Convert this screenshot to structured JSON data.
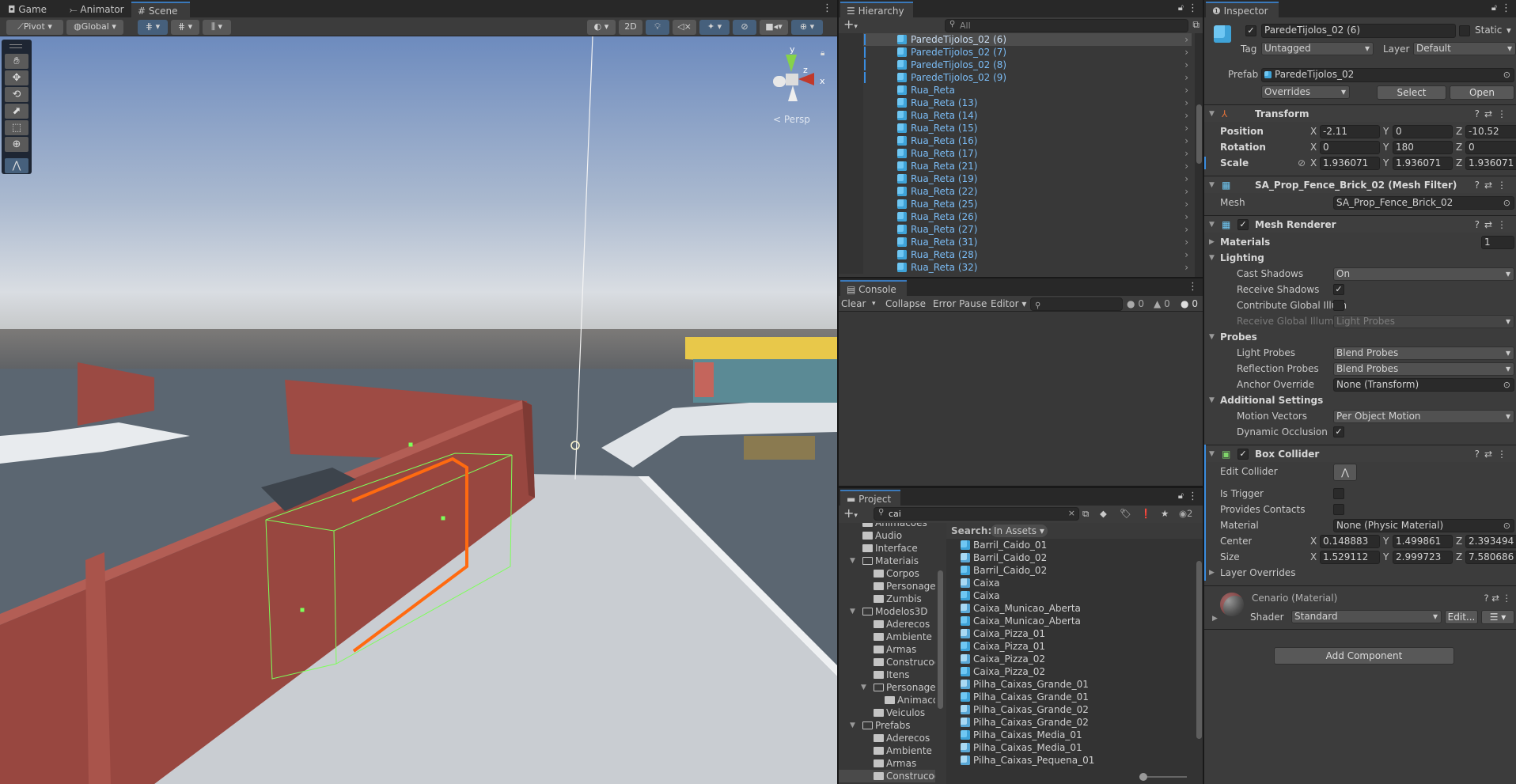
{
  "scene_panel": {
    "tabs": [
      {
        "label": "Game",
        "icon": "gamepad-icon"
      },
      {
        "label": "Animator",
        "icon": "animator-icon"
      },
      {
        "label": "Scene",
        "icon": "grid-hash-icon",
        "active": true
      }
    ],
    "toolbar": {
      "pivot": "Pivot",
      "global": "Global",
      "mode_2d": "2D"
    },
    "tools": [
      "hand-tool",
      "move-tool",
      "rotate-tool",
      "scale-tool",
      "rect-tool",
      "transform-tool",
      "edit-collider-tool"
    ],
    "gizmo": {
      "y": "y",
      "x": "x",
      "z": "z",
      "projection": "Persp"
    },
    "colors": {
      "sky_top": "#6f8cbf",
      "horizon": "#dfe2e4",
      "ground": "#5d6670",
      "brick": "#9b4a43",
      "collider": "#7dff5a",
      "selection": "#ff6a10"
    }
  },
  "hierarchy": {
    "title": "Hierarchy",
    "search_placeholder": "All",
    "items": [
      {
        "label": "ParedeTijolos_02 (6)",
        "selected": true
      },
      {
        "label": "ParedeTijolos_02 (7)"
      },
      {
        "label": "ParedeTijolos_02 (8)"
      },
      {
        "label": "ParedeTijolos_02 (9)"
      },
      {
        "label": "Rua_Reta"
      },
      {
        "label": "Rua_Reta (13)"
      },
      {
        "label": "Rua_Reta (14)"
      },
      {
        "label": "Rua_Reta (15)"
      },
      {
        "label": "Rua_Reta (16)"
      },
      {
        "label": "Rua_Reta (17)"
      },
      {
        "label": "Rua_Reta (21)"
      },
      {
        "label": "Rua_Reta (19)"
      },
      {
        "label": "Rua_Reta (22)"
      },
      {
        "label": "Rua_Reta (25)"
      },
      {
        "label": "Rua_Reta (26)"
      },
      {
        "label": "Rua_Reta (27)"
      },
      {
        "label": "Rua_Reta (31)"
      },
      {
        "label": "Rua_Reta (28)"
      },
      {
        "label": "Rua_Reta (32)"
      }
    ]
  },
  "console": {
    "title": "Console",
    "clear": "Clear",
    "collapse": "Collapse",
    "error_pause": "Error Pause",
    "editor": "Editor",
    "log_count": "0",
    "warning_count": "0",
    "error_count": "0"
  },
  "project": {
    "title": "Project",
    "search_value": "cai",
    "search_label": "Search:",
    "search_scope": "In Assets",
    "hidden_count": "2",
    "tree": [
      {
        "label": "Animacoes",
        "depth": 1
      },
      {
        "label": "Audio",
        "depth": 1
      },
      {
        "label": "Interface",
        "depth": 1
      },
      {
        "label": "Materiais",
        "depth": 1,
        "open": true
      },
      {
        "label": "Corpos",
        "depth": 2
      },
      {
        "label": "Personagens",
        "depth": 2
      },
      {
        "label": "Zumbis",
        "depth": 2
      },
      {
        "label": "Modelos3D",
        "depth": 1,
        "open": true
      },
      {
        "label": "Aderecos",
        "depth": 2
      },
      {
        "label": "Ambiente",
        "depth": 2
      },
      {
        "label": "Armas",
        "depth": 2
      },
      {
        "label": "Construcoes",
        "depth": 2
      },
      {
        "label": "Itens",
        "depth": 2
      },
      {
        "label": "Personagens",
        "depth": 2,
        "open": true
      },
      {
        "label": "Animacoes",
        "depth": 3
      },
      {
        "label": "Veiculos",
        "depth": 2
      },
      {
        "label": "Prefabs",
        "depth": 1,
        "open": true
      },
      {
        "label": "Aderecos",
        "depth": 2
      },
      {
        "label": "Ambiente",
        "depth": 2
      },
      {
        "label": "Armas",
        "depth": 2
      },
      {
        "label": "Construcoes",
        "depth": 2,
        "selected": true
      }
    ],
    "results": [
      {
        "label": "Barril_Caido_01",
        "type": "prefab"
      },
      {
        "label": "Barril_Caido_02",
        "type": "model"
      },
      {
        "label": "Barril_Caido_02",
        "type": "prefab"
      },
      {
        "label": "Caixa",
        "type": "model"
      },
      {
        "label": "Caixa",
        "type": "prefab"
      },
      {
        "label": "Caixa_Municao_Aberta",
        "type": "model"
      },
      {
        "label": "Caixa_Municao_Aberta",
        "type": "prefab"
      },
      {
        "label": "Caixa_Pizza_01",
        "type": "model"
      },
      {
        "label": "Caixa_Pizza_01",
        "type": "prefab"
      },
      {
        "label": "Caixa_Pizza_02",
        "type": "model"
      },
      {
        "label": "Caixa_Pizza_02",
        "type": "prefab"
      },
      {
        "label": "Pilha_Caixas_Grande_01",
        "type": "model"
      },
      {
        "label": "Pilha_Caixas_Grande_01",
        "type": "prefab"
      },
      {
        "label": "Pilha_Caixas_Grande_02",
        "type": "model"
      },
      {
        "label": "Pilha_Caixas_Grande_02",
        "type": "model"
      },
      {
        "label": "Pilha_Caixas_Media_01",
        "type": "prefab"
      },
      {
        "label": "Pilha_Caixas_Media_01",
        "type": "model"
      },
      {
        "label": "Pilha_Caixas_Pequena_01",
        "type": "model"
      }
    ]
  },
  "inspector": {
    "title": "Inspector",
    "object_name": "ParedeTijolos_02 (6)",
    "active": true,
    "static_label": "Static",
    "tag_label": "Tag",
    "tag": "Untagged",
    "layer_label": "Layer",
    "layer": "Default",
    "prefab_label": "Prefab",
    "prefab": "ParedeTijolos_02",
    "overrides": "Overrides",
    "select": "Select",
    "open": "Open",
    "transform": {
      "title": "Transform",
      "position_label": "Position",
      "position": {
        "x": "-2.11",
        "y": "0",
        "z": "-10.52"
      },
      "rotation_label": "Rotation",
      "rotation": {
        "x": "0",
        "y": "180",
        "z": "0"
      },
      "scale_label": "Scale",
      "scale": {
        "x": "1.936071",
        "y": "1.936071",
        "z": "1.936071"
      }
    },
    "mesh_filter": {
      "title": "SA_Prop_Fence_Brick_02 (Mesh Filter)",
      "mesh_label": "Mesh",
      "mesh": "SA_Prop_Fence_Brick_02"
    },
    "mesh_renderer": {
      "title": "Mesh Renderer",
      "materials_label": "Materials",
      "materials_count": "1",
      "lighting": "Lighting",
      "cast_shadows_label": "Cast Shadows",
      "cast_shadows": "On",
      "receive_shadows_label": "Receive Shadows",
      "receive_shadows": true,
      "contribute_gi_label": "Contribute Global Illumination",
      "contribute_gi": false,
      "receive_gi_label": "Receive Global Illumination",
      "receive_gi": "Light Probes",
      "probes": "Probes",
      "light_probes_label": "Light Probes",
      "light_probes": "Blend Probes",
      "reflection_probes_label": "Reflection Probes",
      "reflection_probes": "Blend Probes",
      "anchor_override_label": "Anchor Override",
      "anchor_override": "None (Transform)",
      "additional": "Additional Settings",
      "motion_vectors_label": "Motion Vectors",
      "motion_vectors": "Per Object Motion",
      "dynamic_occlusion_label": "Dynamic Occlusion",
      "dynamic_occlusion": true
    },
    "box_collider": {
      "title": "Box Collider",
      "edit_collider_label": "Edit Collider",
      "is_trigger_label": "Is Trigger",
      "is_trigger": false,
      "provides_contacts_label": "Provides Contacts",
      "provides_contacts": false,
      "material_label": "Material",
      "material": "None (Physic Material)",
      "center_label": "Center",
      "center": {
        "x": "0.148883",
        "y": "1.499861",
        "z": "2.393494"
      },
      "size_label": "Size",
      "size": {
        "x": "1.529112",
        "y": "2.999723",
        "z": "7.580686"
      },
      "layer_overrides": "Layer Overrides"
    },
    "material": {
      "title": "Cenario (Material)",
      "shader_label": "Shader",
      "shader": "Standard",
      "edit": "Edit..."
    },
    "add_component": "Add Component"
  }
}
